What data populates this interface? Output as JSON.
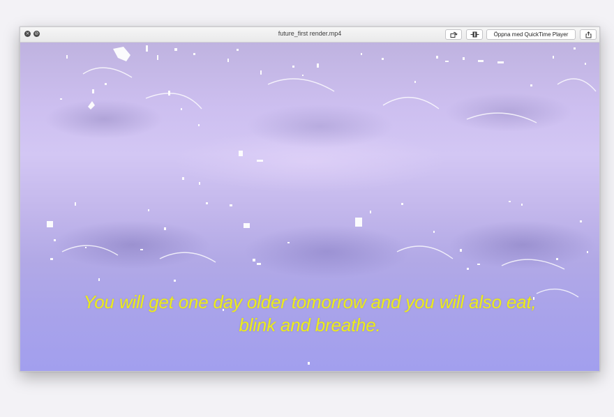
{
  "window": {
    "title": "future_first render.mp4",
    "open_with_label": "Öppna med QuickTime Player"
  },
  "toolbar_icons": [
    "rotate-icon",
    "trim-icon",
    "share-icon"
  ],
  "traffic_lights": [
    "close-icon",
    "minimize-icon"
  ],
  "video": {
    "subtitle_line1": "You will get one day older tomorrow and you will also eat,",
    "subtitle_line2": "blink and breathe.",
    "subtitle_color": "#ecec1c",
    "background_color": "#c4b8ec"
  }
}
